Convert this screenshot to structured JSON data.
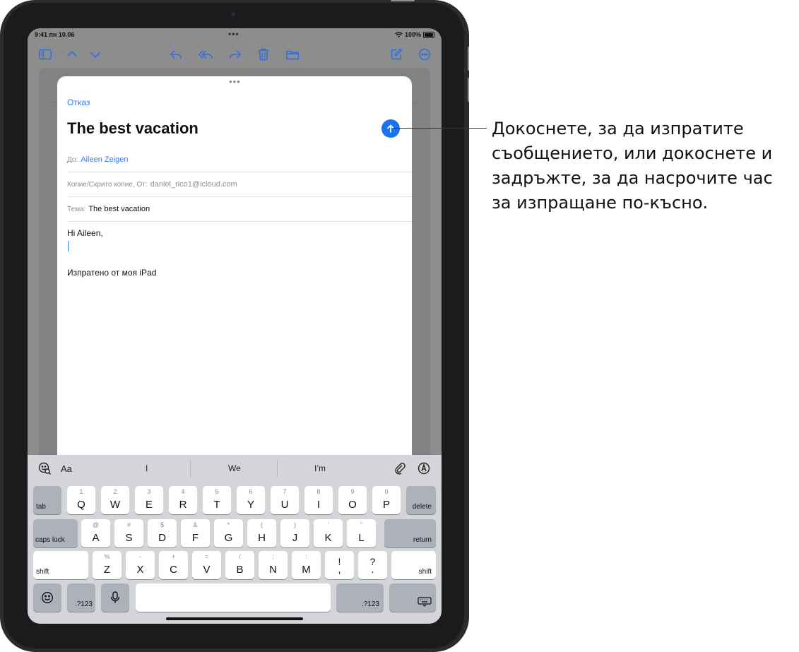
{
  "status_bar": {
    "time": "9:41",
    "date": "пн 10.06",
    "dots": "•••",
    "battery": "100%"
  },
  "toolbar": {
    "icons": [
      "sidebar-icon",
      "chevron-up-icon",
      "chevron-down-icon",
      "reply-icon",
      "reply-all-icon",
      "forward-icon",
      "trash-icon",
      "folder-icon",
      "compose-icon",
      "more-icon"
    ]
  },
  "compose": {
    "cancel_label": "Отказ",
    "title": "The best vacation",
    "to_label": "До:",
    "to_value": "Aileen Zeigen",
    "cc_label": "Копие/Скрито копие, От:",
    "cc_value": "daniel_rico1@icloud.com",
    "subject_label": "Тема:",
    "subject_value": "The best vacation",
    "body_greeting": "Hi Aileen,",
    "signature": "Изпратено от моя iPad"
  },
  "keyboard": {
    "format_label": "Aa",
    "suggestions": [
      "I",
      "We",
      "I’m"
    ],
    "row1": [
      {
        "main": "Q",
        "sec": "1"
      },
      {
        "main": "W",
        "sec": "2"
      },
      {
        "main": "E",
        "sec": "3"
      },
      {
        "main": "R",
        "sec": "4"
      },
      {
        "main": "T",
        "sec": "5"
      },
      {
        "main": "Y",
        "sec": "6"
      },
      {
        "main": "U",
        "sec": "7"
      },
      {
        "main": "I",
        "sec": "8"
      },
      {
        "main": "O",
        "sec": "9"
      },
      {
        "main": "P",
        "sec": "0"
      }
    ],
    "row2": [
      {
        "main": "A",
        "sec": "@"
      },
      {
        "main": "S",
        "sec": "#"
      },
      {
        "main": "D",
        "sec": "$"
      },
      {
        "main": "F",
        "sec": "&"
      },
      {
        "main": "G",
        "sec": "*"
      },
      {
        "main": "H",
        "sec": "("
      },
      {
        "main": "J",
        "sec": ")"
      },
      {
        "main": "K",
        "sec": "’"
      },
      {
        "main": "L",
        "sec": "\""
      }
    ],
    "row3": [
      {
        "main": "Z",
        "sec": "%"
      },
      {
        "main": "X",
        "sec": "-"
      },
      {
        "main": "C",
        "sec": "+"
      },
      {
        "main": "V",
        "sec": "="
      },
      {
        "main": "B",
        "sec": "/"
      },
      {
        "main": "N",
        "sec": ";"
      },
      {
        "main": "M",
        "sec": ":"
      }
    ],
    "punct1": {
      "top": "!",
      "bottom": ","
    },
    "punct2": {
      "top": "?",
      "bottom": "."
    },
    "tab_label": "tab",
    "delete_label": "delete",
    "caps_label": "caps lock",
    "return_label": "return",
    "shift_label": "shift",
    "numbers_label": ".?123"
  },
  "callout": {
    "text": "Докоснете, за да изпратите съобщението, или докоснете и задръжте, за да насрочите час за изпращане по-късно."
  },
  "colors": {
    "accent": "#2f7cf6",
    "send_button": "#1a73f0",
    "keyboard_bg": "#d4d5d9"
  }
}
